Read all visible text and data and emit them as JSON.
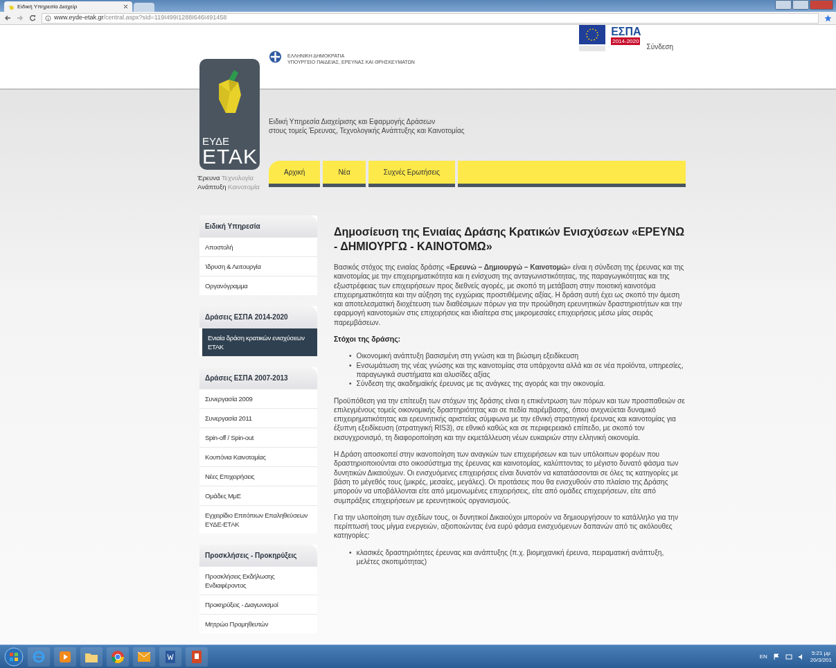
{
  "browser": {
    "tab_title": "Ειδική Υπηρεσία Διαχείρ",
    "url_host": "www.eyde-etak.gr",
    "url_path": "/central.aspx?sId=119I499I1288I646I491458"
  },
  "header": {
    "ministry_lines": [
      "ΕΛΛΗΝΙΚΗ ΔΗΜΟΚΡΑΤΙΑ",
      "ΥΠΟΥΡΓΕΙΟ ΠΑΙΔΕΙΑΣ, ΕΡΕΥΝΑΣ ΚΑΙ ΘΡΗΣΚΕΥΜΑΤΩΝ"
    ],
    "espa_title": "ΕΣΠΑ",
    "espa_period": "2014-2020",
    "login": "Σύνδεση",
    "logo": {
      "small": "ΕΥΔΕ",
      "big": "ΕΤΑΚ",
      "tagline": [
        {
          "text": "Έρευνα",
          "kind": "strong"
        },
        {
          "text": "Τεχνολογία",
          "kind": "light"
        },
        {
          "text": "Ανάπτυξη",
          "kind": "strong"
        },
        {
          "text": "Καινοτομία",
          "kind": "light"
        }
      ]
    },
    "agency_lines": [
      "Ειδική Υπηρεσία Διαχείρισης και Εφαρμογής Δράσεων",
      "στους τομείς Έρευνας, Τεχνολογικής Ανάπτυξης και Καινοτομίας"
    ]
  },
  "nav": [
    {
      "label": "Αρχική",
      "selected": false
    },
    {
      "label": "Νέα",
      "selected": false
    },
    {
      "label": "Συχνές Ερωτήσεις",
      "selected": false
    }
  ],
  "sidebar": [
    {
      "title": "Ειδική Υπηρεσία",
      "items": [
        {
          "label": "Αποστολή",
          "selected": false
        },
        {
          "label": "Ίδρυση & Λειτουργία",
          "selected": false
        },
        {
          "label": "Οργανόγραμμα",
          "selected": false
        }
      ]
    },
    {
      "title": "Δράσεις ΕΣΠΑ 2014-2020",
      "items": [
        {
          "label": "Ενιαία δράση κρατικών ενισχύσεων ΕΤΑΚ",
          "selected": true
        }
      ]
    },
    {
      "title": "Δράσεις ΕΣΠΑ 2007-2013",
      "items": [
        {
          "label": "Συνεργασία 2009",
          "selected": false
        },
        {
          "label": "Συνεργασία 2011",
          "selected": false
        },
        {
          "label": "Spin-off / Spin-out",
          "selected": false
        },
        {
          "label": "Κουπόνια Καινοτομίας",
          "selected": false
        },
        {
          "label": "Νέες Επιχειρήσεις",
          "selected": false
        },
        {
          "label": "Ομάδες ΜμΕ",
          "selected": false
        },
        {
          "label": "Εγχειρίδιο Επιτόπιων Επαληθεύσεων ΕΥΔΕ-ΕΤΑΚ",
          "selected": false
        }
      ]
    },
    {
      "title": "Προσκλήσεις - Προκηρύξεις",
      "items": [
        {
          "label": "Προσκλήσεις Εκδήλωσης Ενδιαφέροντος",
          "selected": false
        },
        {
          "label": "Προκηρύξεις - Διαγωνισμοί",
          "selected": false
        },
        {
          "label": "Μητρώο Προμηθευτών",
          "selected": false
        }
      ]
    }
  ],
  "article": {
    "title": "Δημοσίευση της Ενιαίας Δράσης Κρατικών Ενισχύσεων «ΕΡΕΥΝΩ - ΔΗΜΙΟΥΡΓΩ - ΚΑΙΝΟΤΟΜΩ»",
    "blocks": [
      {
        "kind": "paragraph",
        "text": "Βασικός στόχος της ενιαίας δράσης «**Ερευνώ – Δημιουργώ – Καινοτομώ**» είναι η σύνδεση της έρευνας και της καινοτομίας με την επιχειρηματικότητα και η ενίσχυση της ανταγωνιστικότητας, της παραγωγικότητας και της εξωστρέφειας των επιχειρήσεων προς διεθνείς αγορές, με σκοπό τη μετάβαση στην ποιοτική καινοτόμα επιχειρηματικότητα και την αύξηση της εγχώριας προστιθέμενης αξίας. Η δράση αυτή έχει ως σκοπό την άμεση και αποτελεσματική διοχέτευση των διαθέσιμων πόρων για την προώθηση ερευνητικών δραστηριοτήτων και την εφαρμογή καινοτομιών στις επιχειρήσεις και ιδιαίτερα στις μικρομεσαίες επιχειρήσεις μέσω μίας σειράς παρεμβάσεων."
      },
      {
        "kind": "subheading",
        "text": "Στόχοι της δράσης:"
      },
      {
        "kind": "list",
        "marker": "•",
        "items": [
          "Οικονομική ανάπτυξη βασισμένη στη γνώση και τη βιώσιμη εξειδίκευση",
          "Ενσωμάτωση της νέας γνώσης και της καινοτομίας στα υπάρχοντα αλλά και σε νέα προϊόντα, υπηρεσίες, παραγωγικά συστήματα και αλυσίδες αξίας",
          "Σύνδεση της ακαδημαϊκής έρευνας με τις ανάγκες της αγοράς και την οικονομία."
        ]
      },
      {
        "kind": "paragraph",
        "text": "Προϋπόθεση για την επίτευξη των στόχων της δράσης είναι η επικέντρωση των πόρων και των προσπαθειών σε επιλεγμένους τομείς οικονομικής δραστηριότητας και σε πεδία παρέμβασης, όπου ανιχνεύεται δυναμικό επιχειρηματικότητας και ερευνητικής αριστείας σύμφωνα με την εθνική στρατηγική έρευνας και καινοτομίας για έξυπνη εξειδίκευση (στρατηγική RIS3), σε εθνικό καθώς και σε περιφερειακό επίπεδο, με σκοπό τον εκσυγχρονισμό, τη διαφοροποίηση και την εκμετάλλευση νέων ευκαιριών στην ελληνική οικονομία."
      },
      {
        "kind": "paragraph",
        "text": "Η Δράση αποσκοπεί στην ικανοποίηση των αναγκών των επιχειρήσεων και των υπόλοιπων φορέων που δραστηριοποιούνται στο οικοσύστημα της έρευνας και καινοτομίας, καλύπτοντας το μέγιστο δυνατό φάσμα των δυνητικών Δικαιούχων. Οι ενισχυόμενες  επιχειρήσεις είναι δυνατόν να κατατάσσονται σε όλες τις κατηγορίες με βάση το μέγεθός τους (μικρές, μεσαίες, μεγάλες). Οι προτάσεις που θα ενισχυθούν στο πλαίσιο της Δράσης μπορούν να υποβάλλονται είτε από μεμονωμένες επιχειρήσεις, είτε από ομάδες επιχειρήσεων, είτε από συμπράξεις επιχειρήσεων με ερευνητικούς οργανισμούς."
      },
      {
        "kind": "paragraph",
        "text": "Για την υλοποίηση των σχεδίων τους, οι δυνητικοί Δικαιούχοι μπορούν να δημιουργήσουν το κατάλληλο για την περίπτωσή τους μίγμα ενεργειών, αξιοποιώντας ένα ευρύ φάσμα ενισχυόμενων δαπανών από τις ακόλουθες κατηγορίες:"
      },
      {
        "kind": "list",
        "marker": "•",
        "items": [
          "κλασικές δραστηριότητες έρευνας και ανάπτυξης (π.χ. βιομηχανική έρευνα, πειραματική ανάπτυξη, μελέτες σκοπιμότητας)"
        ]
      }
    ]
  },
  "taskbar": {
    "language": "EN",
    "time": "5:21 μμ",
    "date": "20/3/201"
  }
}
